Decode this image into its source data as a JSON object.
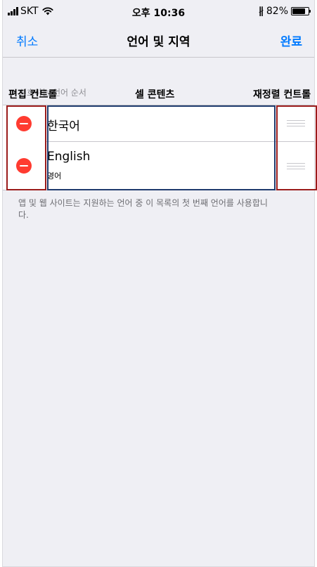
{
  "status_bar": {
    "carrier": "SKT",
    "time": "오후 10:36",
    "battery_percent": "82%",
    "battery_level": 0.82,
    "icons": [
      "signal-icon",
      "wifi-icon",
      "bluetooth-icon",
      "battery-icon"
    ]
  },
  "nav_bar": {
    "cancel_label": "취소",
    "title": "언어 및 지역",
    "done_label": "완료"
  },
  "colors": {
    "accent": "#007aff",
    "delete": "#ff3b30",
    "annotation_red": "#9b1c1c",
    "annotation_blue": "#1f3b6e",
    "background": "#efeff4"
  },
  "section": {
    "header": "선호하는 언어 순서",
    "footer": "앱 및 웹 사이트는 지원하는 언어 중 이 목록의 첫 번째 언어를 사용합니다."
  },
  "languages": [
    {
      "title": "한국어",
      "subtitle": ""
    },
    {
      "title": "English",
      "subtitle": "영어"
    }
  ],
  "annotations": {
    "edit_control": "편집 컨트롤",
    "cell_content": "셀 콘텐츠",
    "reorder_control": "재정렬 컨트롤"
  }
}
